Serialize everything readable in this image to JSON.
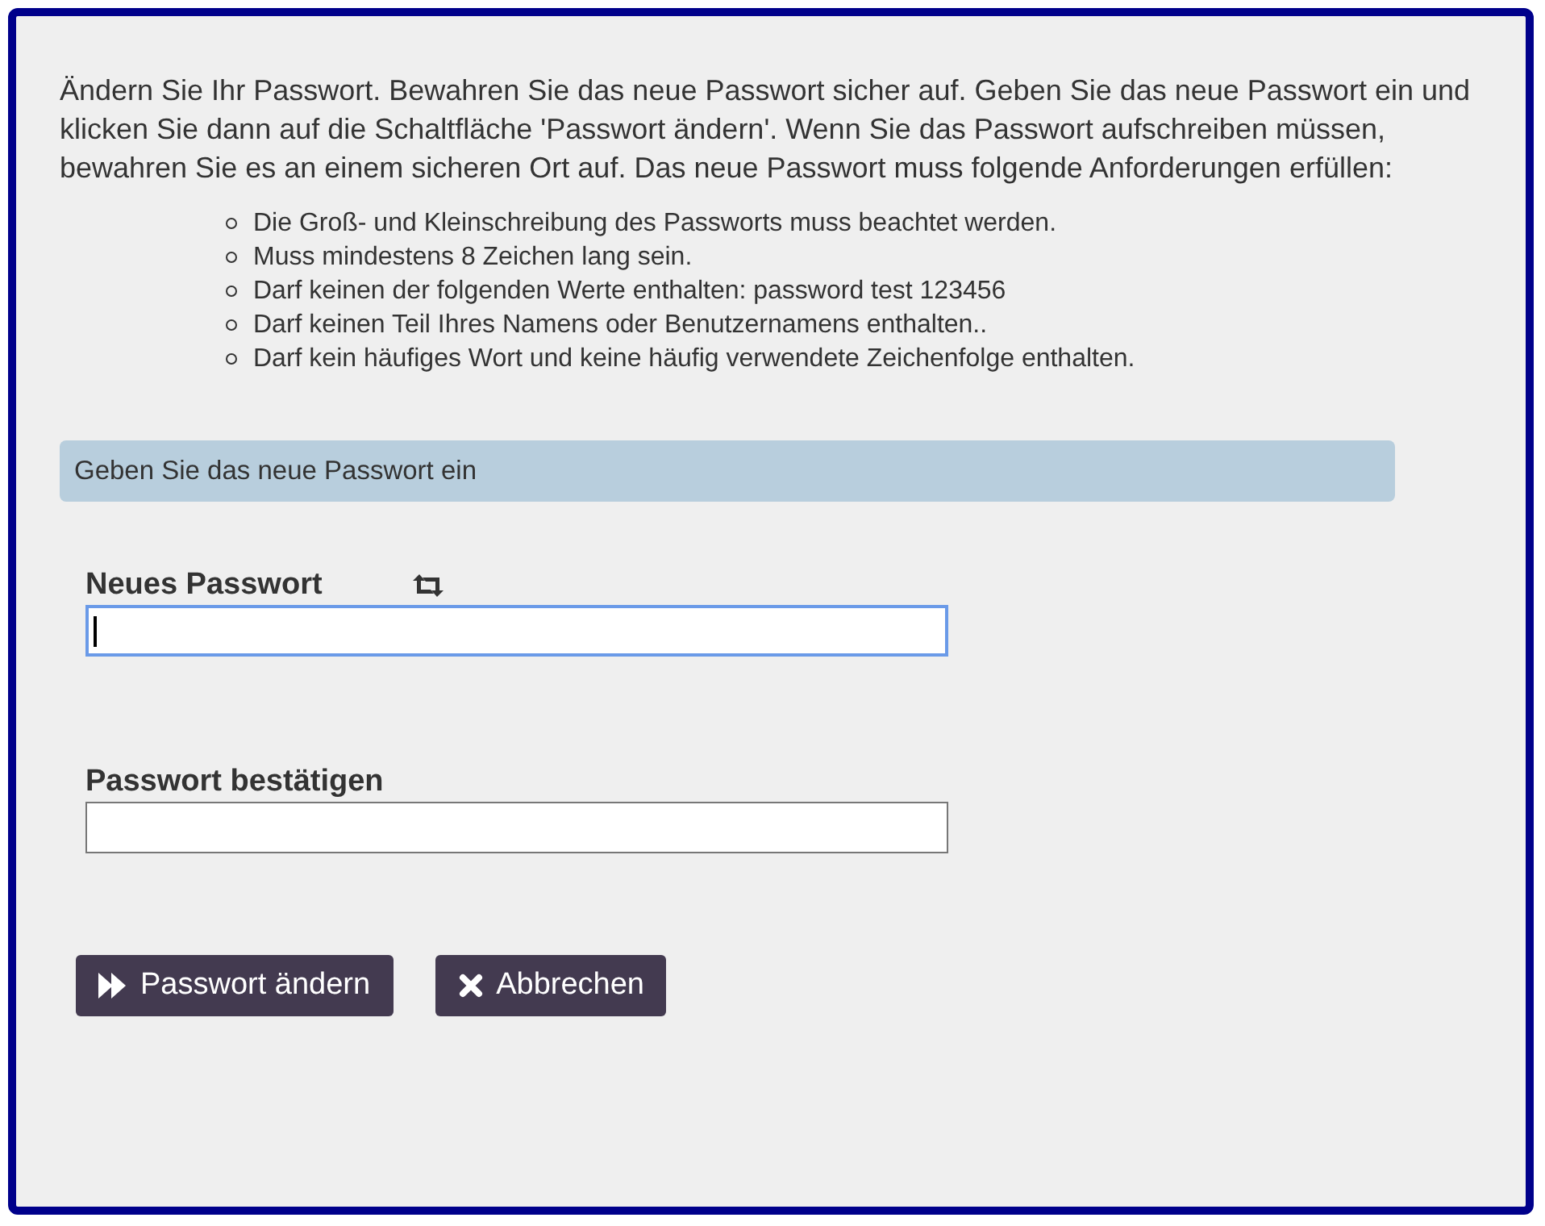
{
  "intro": "Ändern Sie Ihr Passwort. Bewahren Sie das neue Passwort sicher auf. Geben Sie das neue Passwort ein und klicken Sie dann auf die Schaltfläche 'Passwort ändern'. Wenn Sie das Passwort aufschreiben müssen, bewahren Sie es an einem sicheren Ort auf. Das neue Passwort muss folgende Anforderungen erfüllen:",
  "requirements": [
    "Die Groß- und Kleinschreibung des Passworts muss beachtet werden.",
    "Muss mindestens 8 Zeichen lang sein.",
    "Darf keinen der folgenden Werte enthalten: password test 123456",
    "Darf keinen Teil Ihres Namens oder Benutzernamens enthalten..",
    "Darf kein häufiges Wort und keine häufig verwendete Zeichenfolge enthalten."
  ],
  "section_header": "Geben Sie das neue Passwort ein",
  "fields": [
    {
      "label": "Neues Passwort",
      "focused": true,
      "generate_icon": true
    },
    {
      "label": "Passwort bestätigen",
      "focused": false,
      "generate_icon": false
    }
  ],
  "buttons": [
    {
      "kind": "submit",
      "label": "Passwort ändern"
    },
    {
      "kind": "cancel",
      "label": "Abbrechen"
    }
  ]
}
